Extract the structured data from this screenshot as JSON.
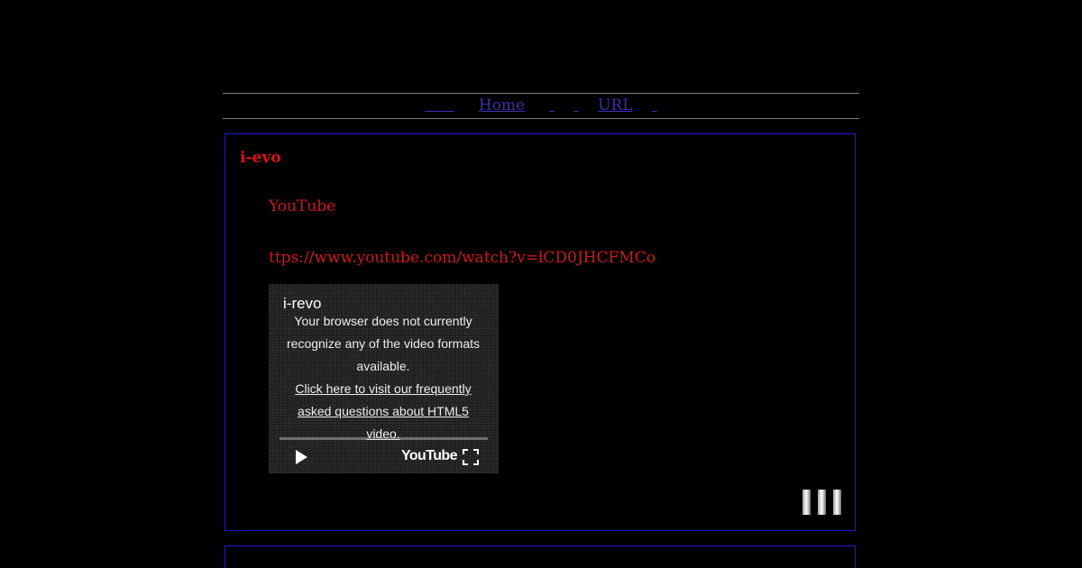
{
  "nav": {
    "items": [
      {
        "label": "Home"
      },
      {
        "label": "URL"
      }
    ]
  },
  "entry": {
    "title": "i-evo",
    "line1": "YouTube",
    "line2": "ttps://www.youtube.com/watch?v=lCD0JHCFMCo"
  },
  "player": {
    "title": "i-revo",
    "message": "Your browser does not currently recognize any of the video formats available.",
    "link_text": "Click here to visit our frequently asked questions about HTML5 video.",
    "logo_text": "YouTube"
  },
  "icons": {
    "play": "play-icon",
    "fullscreen": "fullscreen-icon",
    "bars": "share-bars-icon"
  },
  "colors": {
    "background": "#000000",
    "link": "#3b2fb0",
    "title_red": "#e01010",
    "panel_border": "#1a1acf"
  }
}
